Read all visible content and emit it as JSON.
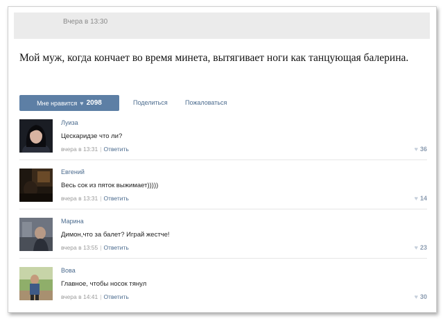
{
  "post": {
    "time": "Вчера в 13:30",
    "text": "Мой муж, когда кончает во время минета, вытягивает ноги как танцующая балерина.",
    "like_label": "Мне нравится",
    "like_count": "2098",
    "share_label": "Поделиться",
    "report_label": "Пожаловаться"
  },
  "comments": [
    {
      "name": "Луиза",
      "text": "Цескаридзе что ли?",
      "time": "вчера в 13:31",
      "reply": "Ответить",
      "likes": "36"
    },
    {
      "name": "Евгений",
      "text": "Весь сок из пяток выжимает)))))",
      "time": "вчера в 13:31",
      "reply": "Ответить",
      "likes": "14"
    },
    {
      "name": "Марина",
      "text": "Димон,что за балет? Играй жестче!",
      "time": "вчера в 13:55",
      "reply": "Ответить",
      "likes": "23"
    },
    {
      "name": "Вова",
      "text": "Главное, чтобы носок тянул",
      "time": "вчера в 14:41",
      "reply": "Ответить",
      "likes": "30"
    }
  ],
  "colors": {
    "link": "#4b6b8e",
    "like_button": "#5d7fa5"
  }
}
